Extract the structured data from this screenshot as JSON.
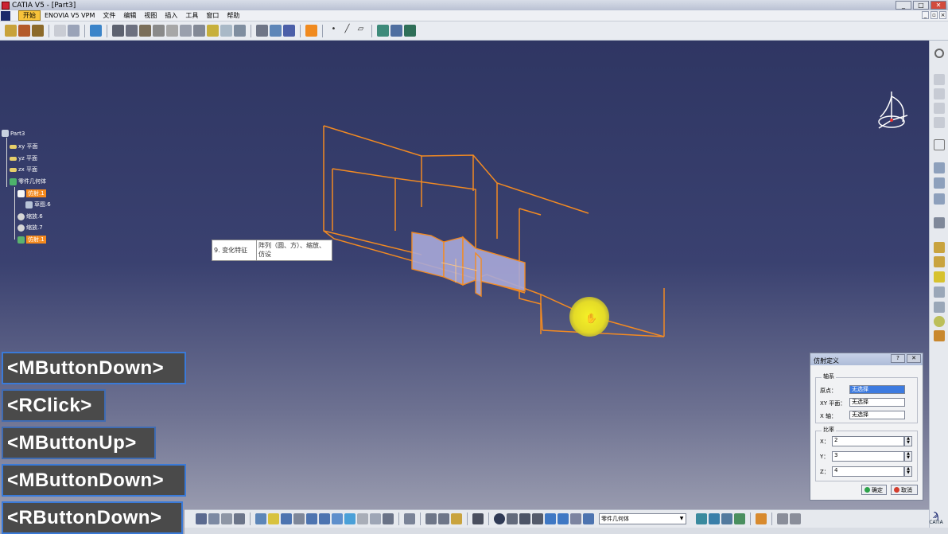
{
  "window": {
    "title": "CATIA V5 - [Part3]",
    "buttons": [
      "_",
      "□",
      "✕"
    ]
  },
  "menubar": {
    "items": [
      "开始",
      "ENOVIA V5 VPM",
      "文件",
      "编辑",
      "视图",
      "插入",
      "工具",
      "窗口",
      "帮助"
    ]
  },
  "tree": {
    "root": "Part3",
    "items": [
      "xy 平面",
      "yz 平面",
      "zx 平面",
      "零件几何体",
      "仿射.1",
      "草图.6",
      "缩放.6",
      "缩放.7",
      "仿射.1"
    ]
  },
  "annotation": {
    "label": "9. 变化特征",
    "text": "阵列（圆、方）、缩放、仿设"
  },
  "dialog": {
    "title": "仿射定义",
    "axis_group": "轴系",
    "origin_label": "原点：",
    "origin_value": "无选择",
    "xy_label": "XY 平面：",
    "xy_value": "无选择",
    "x_axis_label": "X 轴：",
    "x_axis_value": "无选择",
    "ratio_group": "比率",
    "x_label": "X：",
    "x_value": "2",
    "y_label": "Y：",
    "y_value": "3",
    "z_label": "Z：",
    "z_value": "4",
    "ok": "确定",
    "cancel": "取消"
  },
  "bottombar": {
    "body_select": "零件几何体"
  },
  "catia_logo": "CATIA",
  "events": [
    "<MButtonDown>",
    "<RClick>",
    "<MButtonUp>",
    "<MButtonDown>",
    "<RButtonDown>"
  ],
  "colors": {
    "wireframe": "#f28a22",
    "viewport_top": "#2f3663",
    "highlight": "#f6f227",
    "selected_field": "#3d7be0"
  }
}
